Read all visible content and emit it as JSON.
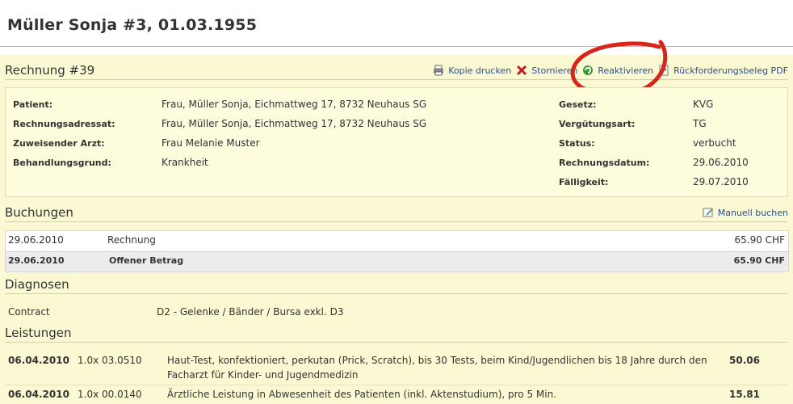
{
  "patient_title": "Müller Sonja #3, 01.03.1955",
  "invoice": {
    "title": "Rechnung #39",
    "actions": [
      {
        "label": "Kopie drucken",
        "icon": "printer-icon"
      },
      {
        "label": "Stornieren",
        "icon": "cancel-x-icon"
      },
      {
        "label": "Reaktivieren",
        "icon": "reactivate-refresh-icon"
      },
      {
        "label": "Rückforderungsbeleg PDF",
        "icon": "pdf-document-icon"
      }
    ],
    "left": [
      {
        "label": "Patient:",
        "value": "Frau, Müller Sonja, Eichmattweg 17, 8732 Neuhaus SG"
      },
      {
        "label": "Rechnungsadressat:",
        "value": "Frau, Müller Sonja, Eichmattweg 17, 8732 Neuhaus SG"
      },
      {
        "label": "Zuweisender Arzt:",
        "value": "Frau Melanie Muster"
      },
      {
        "label": "Behandlungsgrund:",
        "value": "Krankheit"
      }
    ],
    "right": [
      {
        "label": "Gesetz:",
        "value": "KVG"
      },
      {
        "label": "Vergütungsart:",
        "value": "TG"
      },
      {
        "label": "Status:",
        "value": "verbucht"
      },
      {
        "label": "Rechnungsdatum:",
        "value": "29.06.2010"
      },
      {
        "label": "Fälligkeit:",
        "value": "29.07.2010"
      }
    ]
  },
  "bookings": {
    "title": "Buchungen",
    "manual_label": "Manuell buchen",
    "rows": [
      {
        "date": "29.06.2010",
        "desc": "Rechnung",
        "amount": "65.90 CHF"
      }
    ],
    "total": {
      "date": "29.06.2010",
      "desc": "Offener Betrag",
      "amount": "65.90 CHF"
    }
  },
  "diagnoses": {
    "title": "Diagnosen",
    "rows": [
      {
        "type": "Contract",
        "desc": "D2 - Gelenke / Bänder / Bursa exkl. D3"
      }
    ]
  },
  "services": {
    "title": "Leistungen",
    "rows": [
      {
        "date": "06.04.2010",
        "qty": "1.0x",
        "code": "03.0510",
        "desc1": "Haut-Test, konfektioniert, perkutan (Prick, Scratch), bis 30 Tests, beim Kind/Jugendlichen bis 18 Jahre durch den",
        "desc2": "Facharzt für Kinder- und Jugendmedizin",
        "amount": "50.06"
      },
      {
        "date": "06.04.2010",
        "qty": "1.0x",
        "code": "00.0140",
        "desc1": "Ärztliche Leistung in Abwesenheit des Patienten (inkl. Aktenstudium), pro 5 Min.",
        "desc2": "",
        "amount": "15.81"
      }
    ]
  },
  "colors": {
    "link": "#2a4f8a",
    "panel_bg": "#fbf9d4",
    "highlight_circle": "#d8251c"
  }
}
